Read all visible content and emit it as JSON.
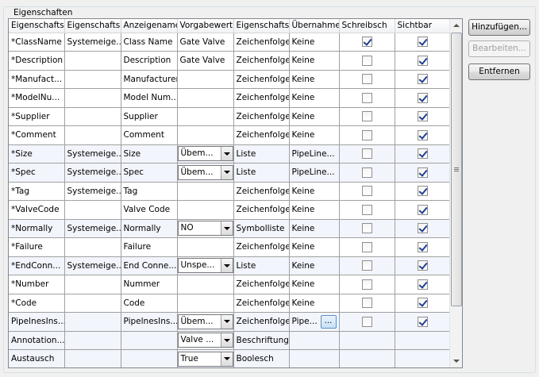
{
  "group_title": "Eigenschaften",
  "columns": [
    "Eigenschafts",
    "Eigenschaftsl",
    "Anzeigename",
    "Vorgabewert",
    "Eigenschaftst",
    "Übernahme",
    "Schreibsch",
    "Sichtbar"
  ],
  "rows": [
    {
      "name": "*ClassName",
      "source": "Systemeige...",
      "display": "Class Name",
      "default": "Gate Valve",
      "default_combo": false,
      "type": "Zeichenfolge",
      "transfer": "Keine",
      "readonly": true,
      "visible": true
    },
    {
      "name": "*Description",
      "source": "",
      "display": "Description",
      "default": "Gate Valve",
      "default_combo": false,
      "type": "Zeichenfolge",
      "transfer": "Keine",
      "readonly": false,
      "visible": true
    },
    {
      "name": "*Manufact...",
      "source": "",
      "display": "Manufacturer",
      "default": "",
      "default_combo": false,
      "type": "Zeichenfolge",
      "transfer": "Keine",
      "readonly": false,
      "visible": true
    },
    {
      "name": "*ModelNu...",
      "source": "",
      "display": "Model Num...",
      "default": "",
      "default_combo": false,
      "type": "Zeichenfolge",
      "transfer": "Keine",
      "readonly": false,
      "visible": true
    },
    {
      "name": "*Supplier",
      "source": "",
      "display": "Supplier",
      "default": "",
      "default_combo": false,
      "type": "Zeichenfolge",
      "transfer": "Keine",
      "readonly": false,
      "visible": true
    },
    {
      "name": "*Comment",
      "source": "",
      "display": "Comment",
      "default": "",
      "default_combo": false,
      "type": "Zeichenfolge",
      "transfer": "Keine",
      "readonly": false,
      "visible": true
    },
    {
      "name": "*Size",
      "source": "Systemeige...",
      "display": "Size",
      "default": "Übem...",
      "default_combo": true,
      "type": "Liste",
      "transfer": "PipeLine...",
      "readonly": false,
      "visible": true
    },
    {
      "name": "*Spec",
      "source": "Systemeige...",
      "display": "Spec",
      "default": "Übem...",
      "default_combo": true,
      "type": "Liste",
      "transfer": "PipeLine...",
      "readonly": false,
      "visible": true
    },
    {
      "name": "*Tag",
      "source": "Systemeige...",
      "display": "Tag",
      "default": "",
      "default_combo": false,
      "type": "Zeichenfolge",
      "transfer": "Keine",
      "readonly": false,
      "visible": true
    },
    {
      "name": "*ValveCode",
      "source": "",
      "display": "Valve Code",
      "default": "",
      "default_combo": false,
      "type": "Zeichenfolge",
      "transfer": "Keine",
      "readonly": false,
      "visible": true
    },
    {
      "name": "*Normally",
      "source": "Systemeige...",
      "display": "Normally",
      "default": "NO",
      "default_combo": true,
      "type": "Symbolliste",
      "transfer": "Keine",
      "readonly": false,
      "visible": true
    },
    {
      "name": "*Failure",
      "source": "",
      "display": "Failure",
      "default": "",
      "default_combo": false,
      "type": "Zeichenfolge",
      "transfer": "Keine",
      "readonly": false,
      "visible": true
    },
    {
      "name": "*EndConn...",
      "source": "Systemeige...",
      "display": "End Conne...",
      "default": "Unspe...",
      "default_combo": true,
      "type": "Liste",
      "transfer": "Keine",
      "readonly": false,
      "visible": true
    },
    {
      "name": "*Number",
      "source": "",
      "display": "Nummer",
      "default": "",
      "default_combo": false,
      "type": "Zeichenfolge",
      "transfer": "Keine",
      "readonly": false,
      "visible": true
    },
    {
      "name": "*Code",
      "source": "",
      "display": "Code",
      "default": "",
      "default_combo": false,
      "type": "Zeichenfolge",
      "transfer": "Keine",
      "readonly": false,
      "visible": true
    },
    {
      "name": "PipelnesIns...",
      "source": "",
      "display": "PipelnesIns...",
      "default": "Übem...",
      "default_combo": true,
      "type": "Zeichenfolge",
      "transfer": "Pipe...",
      "transfer_button": "...",
      "readonly": false,
      "visible": true
    },
    {
      "name": "Annotation...",
      "source": "",
      "display": "",
      "default": "Valve ...",
      "default_combo": true,
      "type": "Beschriftung",
      "transfer": "",
      "readonly": null,
      "visible": null
    },
    {
      "name": "Austausch",
      "source": "",
      "display": "",
      "default": "True",
      "default_combo": true,
      "type": "Boolesch",
      "transfer": "",
      "readonly": null,
      "visible": null
    }
  ],
  "buttons": {
    "add": "Hinzufügen...",
    "edit": "Bearbeiten...",
    "remove": "Entfernen"
  },
  "colors": {
    "alt_row": "#f2f5fc",
    "grid_line": "#a0a0a0",
    "check": "#1f3f8f"
  }
}
